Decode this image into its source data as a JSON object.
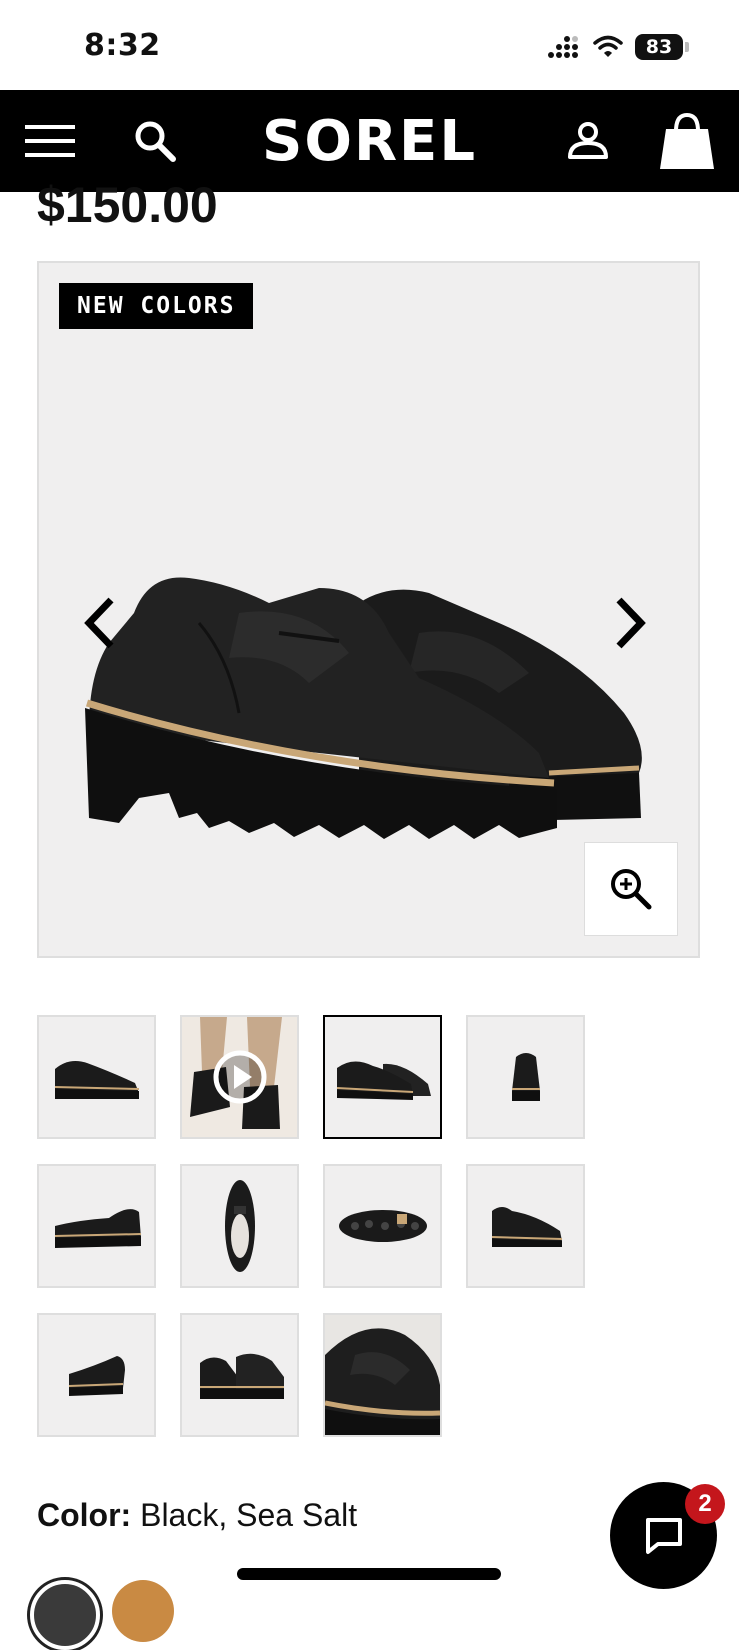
{
  "status_bar": {
    "time": "8:32",
    "battery": "83"
  },
  "header": {
    "logo": "SOREL",
    "icons": [
      "menu-icon",
      "search-icon",
      "account-icon",
      "bag-icon"
    ]
  },
  "product": {
    "price": "$150.00",
    "badge": "NEW COLORS",
    "color_label": "Color:",
    "color_value": " Black, Sea Salt"
  },
  "gallery": {
    "thumbnail_count": 11,
    "selected_index": 2,
    "video_index": 1
  },
  "chat": {
    "unread_count": "2"
  },
  "colors": {
    "background": "#ffffff",
    "header": "#000000",
    "image_bg": "#f0efef",
    "badge_red": "#c4161c"
  }
}
